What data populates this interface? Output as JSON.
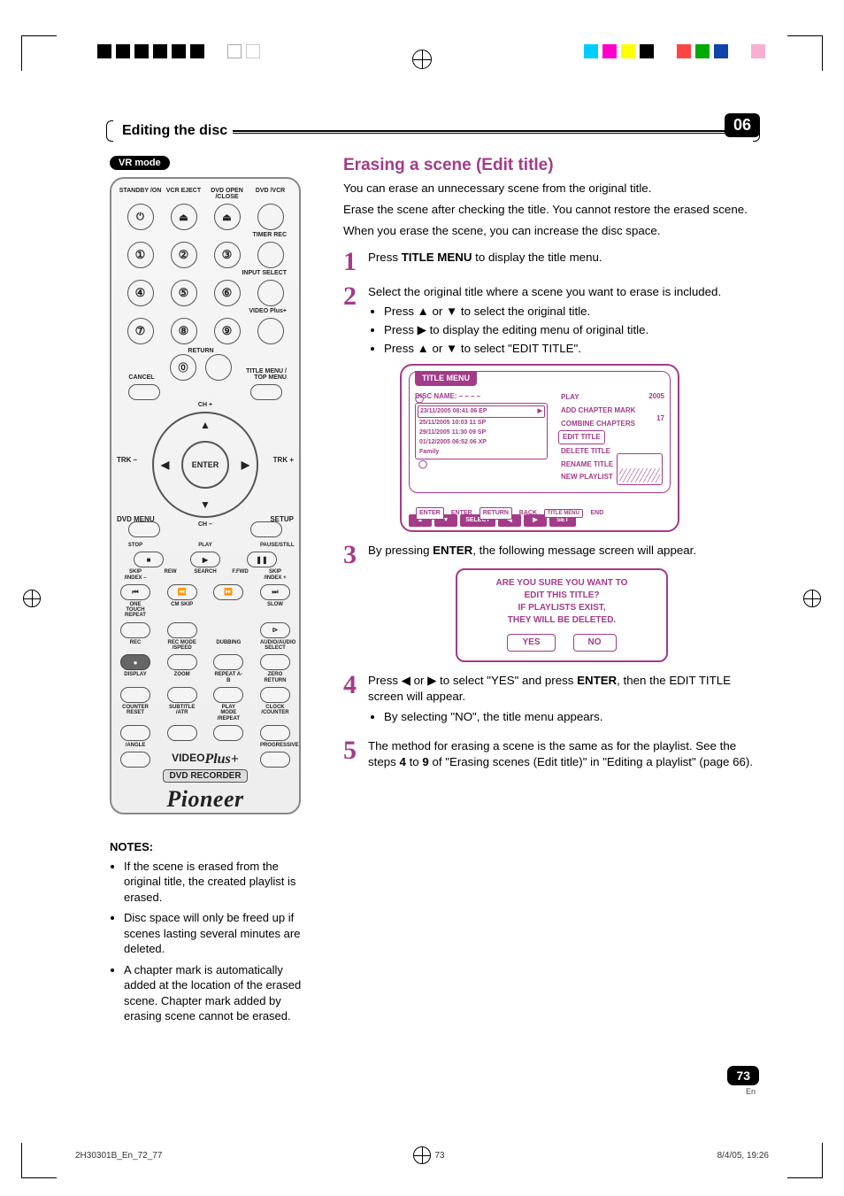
{
  "chapter": {
    "title": "Editing the disc",
    "number": "06"
  },
  "vr_badge": "VR mode",
  "section": {
    "heading": "Erasing a scene (Edit title)",
    "intro1": "You can erase an unnecessary scene from the original title.",
    "intro2": "Erase the scene after checking the title. You cannot restore the erased scene.",
    "intro3": "When you erase the scene, you can increase the disc space."
  },
  "steps": {
    "s1": {
      "num": "1",
      "text_a": "Press ",
      "bold": "TITLE MENU",
      "text_b": " to display the title menu."
    },
    "s2": {
      "num": "2",
      "lead": "Select the original title where a scene you want to erase is included.",
      "bullets": [
        "Press ▲ or ▼ to select the original title.",
        "Press ▶ to display the editing menu of original title.",
        "Press ▲ or ▼ to select \"EDIT TITLE\"."
      ]
    },
    "s3": {
      "num": "3",
      "text_a": "By pressing ",
      "bold": "ENTER",
      "text_b": ", the following message screen will appear."
    },
    "s4": {
      "num": "4",
      "text_a": "Press ◀ or ▶ to select \"YES\" and press ",
      "bold": "ENTER",
      "text_b": ", then the EDIT TITLE screen will appear.",
      "bullet": "By selecting \"NO\", the title menu appears."
    },
    "s5": {
      "num": "5",
      "text_a": "The method for erasing a scene is the same as for the playlist. See the steps ",
      "bold_a": "4",
      "mid": " to ",
      "bold_b": "9",
      "text_b": " of \"Erasing scenes (Edit title)\" in \"Editing a playlist\" (page 66)."
    }
  },
  "osd": {
    "tab": "TITLE MENU",
    "disc_name_label": "DISC NAME: – – – –",
    "list": [
      {
        "t": "23/11/2005 08:41 06 EP"
      },
      {
        "t": "25/11/2005 10:03 11 SP"
      },
      {
        "t": "29/11/2005 11:30 09 SP"
      },
      {
        "t": "01/12/2005 06:52 06 XP"
      },
      {
        "t": "Family"
      }
    ],
    "right_menu": [
      "PLAY",
      "ADD CHAPTER MARK",
      "COMBINE CHAPTERS",
      "EDIT TITLE",
      "DELETE TITLE",
      "RENAME TITLE",
      "NEW PLAYLIST"
    ],
    "extra_right": [
      "2005",
      "17"
    ],
    "footer": {
      "k1": "▲",
      "k2": "▼",
      "l1": "SELECT",
      "k3": "◀",
      "k4": "▶",
      "l2": "SET",
      "b1": "ENTER",
      "b1l": "ENTER",
      "b2": "RETURN",
      "b2l": "BACK",
      "b3": "TITLE MENU",
      "b3l": "END"
    }
  },
  "dialog": {
    "l1": "ARE YOU SURE YOU WANT TO",
    "l2": "EDIT THIS TITLE?",
    "l3": "IF PLAYLISTS EXIST,",
    "l4": "THEY WILL BE DELETED.",
    "yes": "YES",
    "no": "NO"
  },
  "notes": {
    "heading": "NOTES:",
    "items": [
      "If the scene is erased from the original title, the created playlist is erased.",
      "Disc space will only be freed up if scenes lasting several minutes are deleted.",
      "A chapter mark is automatically added at the location of the erased scene. Chapter mark added by erasing scene cannot be erased."
    ]
  },
  "remote": {
    "top": [
      "STANDBY /ON",
      "VCR EJECT",
      "DVD OPEN /CLOSE",
      "DVD /VCR"
    ],
    "timer_rec": "TIMER REC",
    "input_select": "INPUT SELECT",
    "video_plus": "VIDEO Plus+",
    "return": "RETURN",
    "cancel": "CANCEL",
    "title_menu": "TITLE MENU / TOP MENU",
    "ch_plus": "CH +",
    "ch_minus": "CH –",
    "trk_minus": "TRK –",
    "trk_plus": "TRK +",
    "enter": "ENTER",
    "dvd_menu": "DVD MENU",
    "setup": "SETUP",
    "playbar": [
      "STOP",
      "PLAY",
      "PAUSE/STILL"
    ],
    "searchbar_top": [
      "SKIP /INDEX –",
      "REW",
      "F.FWD",
      "SKIP /INDEX +"
    ],
    "search_label": "SEARCH",
    "row_a_labels": [
      "ONE TOUCH REPEAT",
      "CM SKIP",
      "",
      "SLOW"
    ],
    "row_b_labels": [
      "REC",
      "REC MODE /SPEED",
      "DUBBING",
      "AUDIO/AUDIO SELECT"
    ],
    "row_c_labels": [
      "DISPLAY",
      "ZOOM",
      "REPEAT A-B",
      "ZERO RETURN"
    ],
    "row_d_labels": [
      "COUNTER RESET",
      "SUBTITLE /ATR",
      "PLAY MODE /REPEAT",
      "CLOCK /COUNTER"
    ],
    "angle": "/ANGLE",
    "progressive": "PROGRESSIVE",
    "video_logo": "VIDEO",
    "plus_script": "Plus+",
    "bar": "DVD RECORDER",
    "brand": "Pioneer"
  },
  "page": {
    "num": "73",
    "lang": "En"
  },
  "footer": {
    "left": "2H30301B_En_72_77",
    "mid": "73",
    "right": "8/4/05, 19:26"
  },
  "crop_colors_left": [
    "#000",
    "#000",
    "#000",
    "#000",
    "#000",
    "#000",
    "#fff",
    "#fff",
    "#fff"
  ],
  "crop_colors_right": [
    "#0bf",
    "#f0c",
    "#ff0",
    "#f44",
    "#0a0",
    "#00a",
    "#fff",
    "#f8c",
    "#fff"
  ]
}
